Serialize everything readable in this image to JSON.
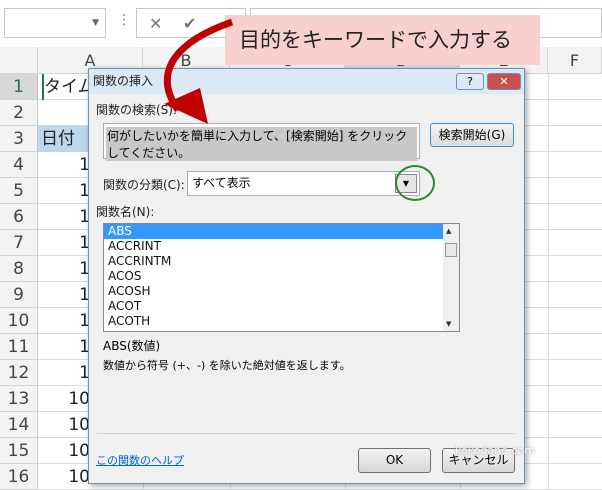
{
  "formula_bar": {
    "cancel_icon": "✕",
    "enter_icon": "✔"
  },
  "columns": [
    "A",
    "B",
    "C",
    "D",
    "E",
    "F"
  ],
  "rows": [
    "1",
    "2",
    "3",
    "4",
    "5",
    "6",
    "7",
    "8",
    "9",
    "10",
    "11",
    "12",
    "13",
    "14",
    "15",
    "16"
  ],
  "cells_a": [
    "タイム",
    "",
    "日付",
    "1",
    "1",
    "1",
    "1",
    "1",
    "1",
    "1",
    "1",
    "1",
    "10",
    "10",
    "10",
    "10"
  ],
  "callout": "目的をキーワードで入力する",
  "dialog": {
    "title": "関数の挿入",
    "help_btn": "?",
    "close_btn": "✕",
    "search_label": "関数の検索(S):",
    "search_value": "何がしたいかを簡単に入力して、[検索開始] をクリックしてください。",
    "search_button": "検索開始(G)",
    "category_label": "関数の分類(C):",
    "category_value": "すべて表示",
    "funcname_label": "関数名(N):",
    "functions": [
      "ABS",
      "ACCRINT",
      "ACCRINTM",
      "ACOS",
      "ACOSH",
      "ACOT",
      "ACOTH"
    ],
    "signature": "ABS(数値)",
    "description": "数値から符号 (+、-) を除いた絶対値を返します。",
    "help_link": "この関数のヘルプ",
    "ok": "OK",
    "cancel": "キャンセル"
  },
  "watermark": "kokodane.com"
}
